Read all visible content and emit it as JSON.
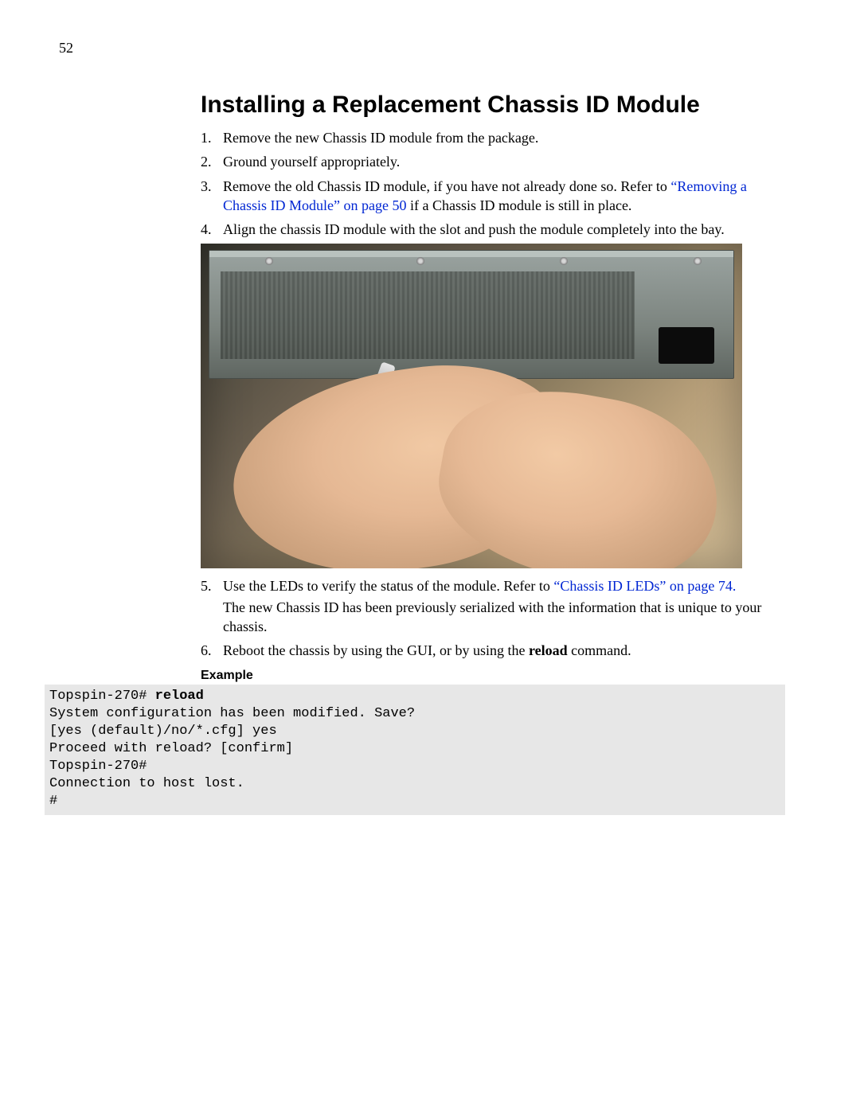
{
  "page_number": "52",
  "heading": "Installing a Replacement Chassis ID Module",
  "steps": {
    "s1": {
      "num": "1.",
      "text": "Remove the new Chassis ID module from the package."
    },
    "s2": {
      "num": "2.",
      "text": "Ground yourself appropriately."
    },
    "s3": {
      "num": "3.",
      "pre": "Remove the old Chassis ID module, if you have not already done so. Refer to ",
      "link": "“Removing a Chassis ID Module” on page 50",
      "post": " if a Chassis ID module is still in place."
    },
    "s4": {
      "num": "4.",
      "text": "Align the chassis ID module with the slot and push the module completely into the bay."
    },
    "s5": {
      "num": "5.",
      "pre": "Use the LEDs to verify the status of the module. Refer to ",
      "link": "“Chassis ID LEDs” on page 74.",
      "extra": "The new Chassis ID has been previously serialized with the information that is unique to your chassis."
    },
    "s6": {
      "num": "6.",
      "pre": "Reboot the chassis by using the GUI, or by using the ",
      "bold": "reload",
      "post": " command."
    }
  },
  "example_label": "Example",
  "code": {
    "l1_prompt": "Topspin-270# ",
    "l1_cmd": "reload",
    "l2": "System configuration has been modified. Save?",
    "l3": "[yes (default)/no/*.cfg] yes",
    "l4": "Proceed with reload? [confirm]",
    "l5": "Topspin-270#",
    "l6": "Connection to host lost.",
    "l7": "#"
  },
  "figure_alt": "Hands installing a Chassis ID module into a rack chassis"
}
